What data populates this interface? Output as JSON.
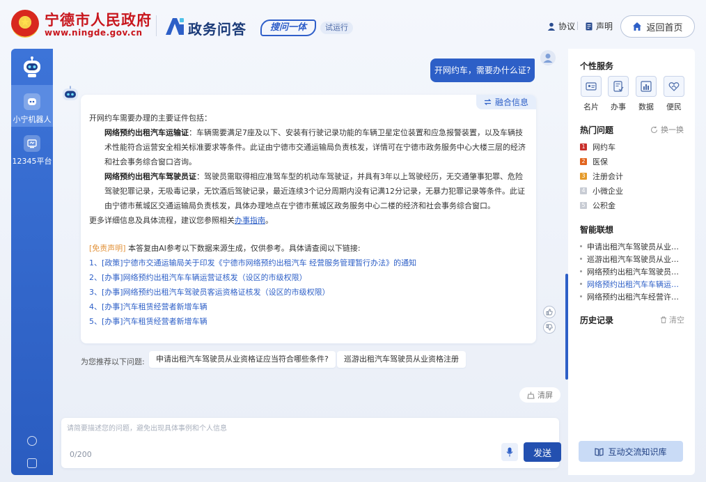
{
  "header": {
    "gov_name": "宁德市人民政府",
    "gov_url": "www.ningde.gov.cn",
    "service_title": "政务问答",
    "search_slogan": "搜问一体",
    "trial_badge": "试运行",
    "agreement": "协议",
    "statement": "声明",
    "back_home": "返回首页"
  },
  "leftnav": {
    "items": [
      {
        "label": "小宁机器人",
        "active": true
      },
      {
        "label": "12345平台",
        "active": false
      }
    ]
  },
  "chat": {
    "user_question": "开网约车，需要办什么证?",
    "fusion_tag": "融合信息",
    "answer_intro": "开网约车需要办理的主要证件包括：",
    "cert1_title": "网络预约出租汽车运输证",
    "cert1_text": "：车辆需要满足7座及以下、安装有行驶记录功能的车辆卫星定位装置和应急报警装置，以及车辆技术性能符合运营安全相关标准要求等条件。此证由宁德市交通运输局负责核发，详情可在宁德市政务服务中心大楼三层的经济和社会事务综合窗口咨询。",
    "cert2_title": "网络预约出租汽车驾驶员证",
    "cert2_text": "：驾驶员需取得相应准驾车型的机动车驾驶证，并具有3年以上驾驶经历，无交通肇事犯罪、危险驾驶犯罪记录，无吸毒记录，无饮酒后驾驶记录，最近连续3个记分周期内没有记满12分记录，无暴力犯罪记录等条件。此证由宁德市蕉城区交通运输局负责核发，具体办理地点在宁德市蕉城区政务服务中心二楼的经济和社会事务综合窗口。",
    "more_prefix": "更多详细信息及具体流程，建议您参照相关",
    "more_link": "办事指南",
    "more_suffix": "。",
    "disclaimer_tag": "[免责声明]",
    "disclaimer_text": " 本答复由AI参考以下数据来源生成，仅供参考。具体请查阅以下链接:",
    "references": [
      "1、[政策]宁德市交通运输局关于印发《宁德市网络预约出租汽车 经营服务管理暂行办法》的通知",
      "2、[办事]网络预约出租汽车车辆运营证核发（设区的市级权限）",
      "3、[办事]网络预约出租汽车驾驶员客运资格证核发（设区的市级权限）",
      "4、[办事]汽车租赁经营者新增车辆",
      "5、[办事]汽车租赁经营者新增车辆"
    ],
    "suggest_label": "为您推荐以下问题:",
    "suggestions": [
      "申请出租汽车驾驶员从业资格证应当符合哪些条件?",
      "巡游出租汽车驾驶员从业资格注册"
    ],
    "clear_label": "清屏"
  },
  "composer": {
    "placeholder": "请简要描述您的问题，避免出现具体事例和个人信息",
    "char_count": "0/200",
    "send_label": "发送"
  },
  "rightpanel": {
    "personal_title": "个性服务",
    "services": [
      {
        "label": "名片",
        "icon": "card-icon"
      },
      {
        "label": "办事",
        "icon": "task-icon"
      },
      {
        "label": "数据",
        "icon": "chart-icon"
      },
      {
        "label": "便民",
        "icon": "heart-hand-icon"
      }
    ],
    "hot_title": "热门问题",
    "refresh_label": "换一换",
    "hot_items": [
      {
        "num": "1",
        "label": "网约车",
        "color": "#c9302c"
      },
      {
        "num": "2",
        "label": "医保",
        "color": "#e2641e"
      },
      {
        "num": "3",
        "label": "注册会计",
        "color": "#e59b2a"
      },
      {
        "num": "4",
        "label": "小微企业",
        "color": "#c8ccd4"
      },
      {
        "num": "5",
        "label": "公积金",
        "color": "#c8ccd4"
      }
    ],
    "assoc_title": "智能联想",
    "assoc_items": [
      "申请出租汽车驾驶员从业资格证",
      "巡游出租汽车驾驶员从业资格注册",
      "网络预约出租汽车驾驶员客运资格证核发",
      "网络预约出租汽车车辆运营证核发",
      "网络预约出租汽车经营许可证核发"
    ],
    "history_title": "历史记录",
    "history_clear": "清空",
    "kb_button": "互动交流知识库"
  }
}
